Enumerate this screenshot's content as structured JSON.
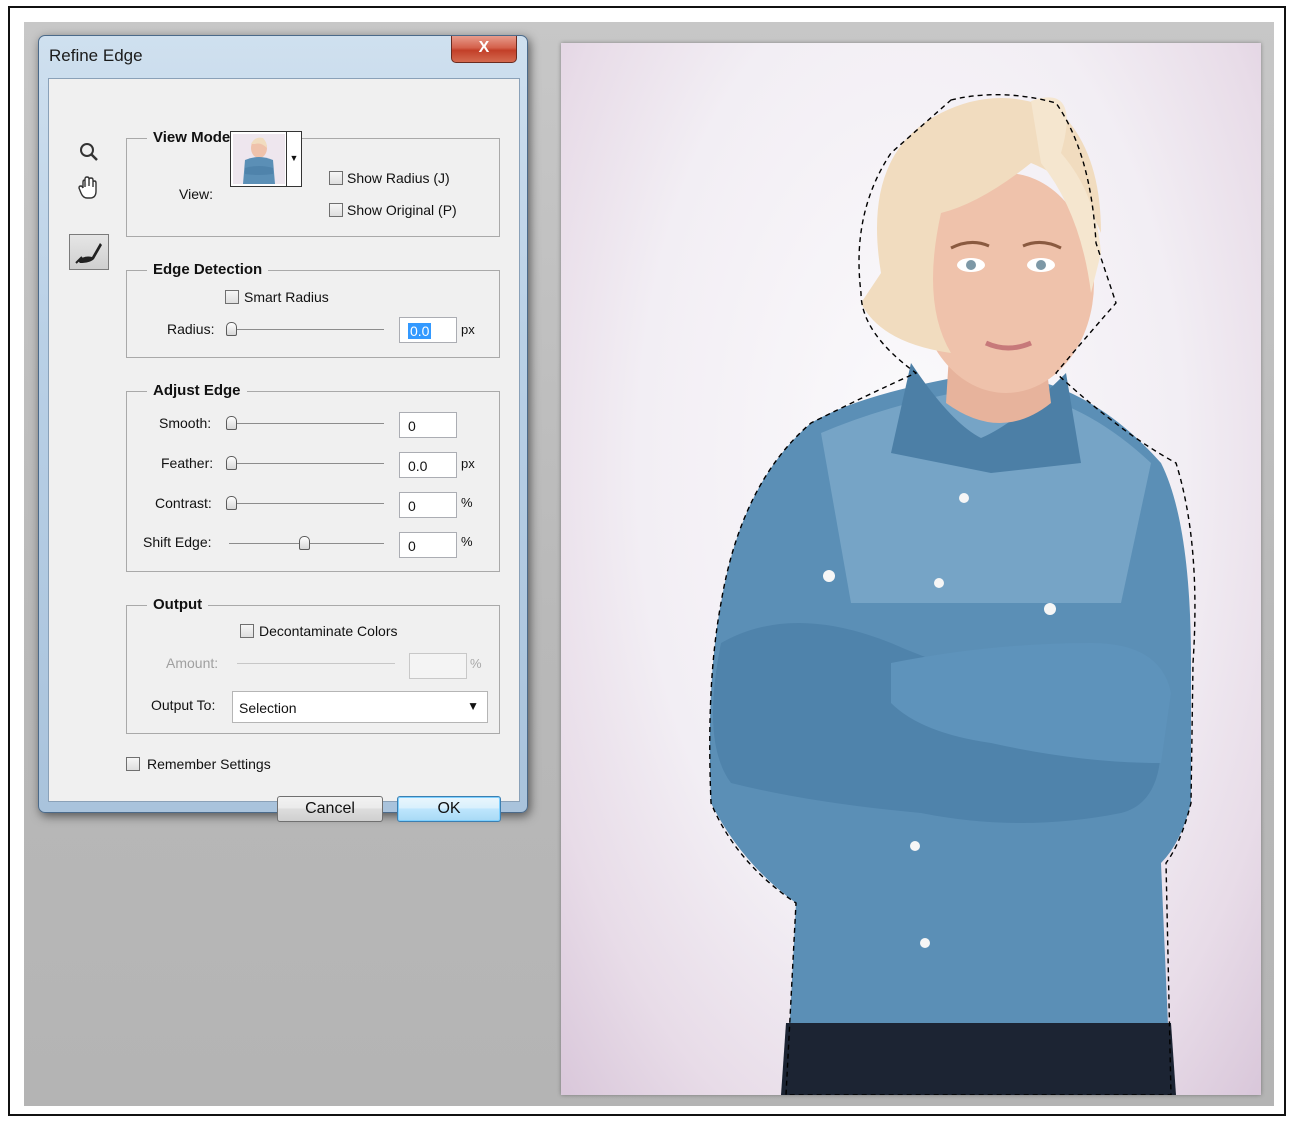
{
  "dialog": {
    "title": "Refine Edge",
    "close_label": "X",
    "view_mode": {
      "title": "View Mode",
      "view_label": "View:",
      "show_radius": "Show Radius (J)",
      "show_original": "Show Original (P)"
    },
    "edge_detection": {
      "title": "Edge Detection",
      "smart_radius": "Smart Radius",
      "radius_label": "Radius:",
      "radius_value": "0.0",
      "radius_unit": "px"
    },
    "adjust_edge": {
      "title": "Adjust Edge",
      "smooth_label": "Smooth:",
      "smooth_value": "0",
      "feather_label": "Feather:",
      "feather_value": "0.0",
      "feather_unit": "px",
      "contrast_label": "Contrast:",
      "contrast_value": "0",
      "contrast_unit": "%",
      "shift_label": "Shift Edge:",
      "shift_value": "0",
      "shift_unit": "%"
    },
    "output": {
      "title": "Output",
      "decontaminate": "Decontaminate Colors",
      "amount_label": "Amount:",
      "amount_unit": "%",
      "output_to_label": "Output To:",
      "output_to_value": "Selection"
    },
    "remember_settings": "Remember Settings",
    "cancel_label": "Cancel",
    "ok_label": "OK"
  },
  "sliders": {
    "radius": 0,
    "smooth": 0,
    "feather": 0,
    "contrast": 0,
    "shift_edge": 0.5
  },
  "icons": {
    "zoom": "zoom-icon",
    "hand": "hand-icon",
    "refine_brush": "refine-radius-brush-icon"
  }
}
